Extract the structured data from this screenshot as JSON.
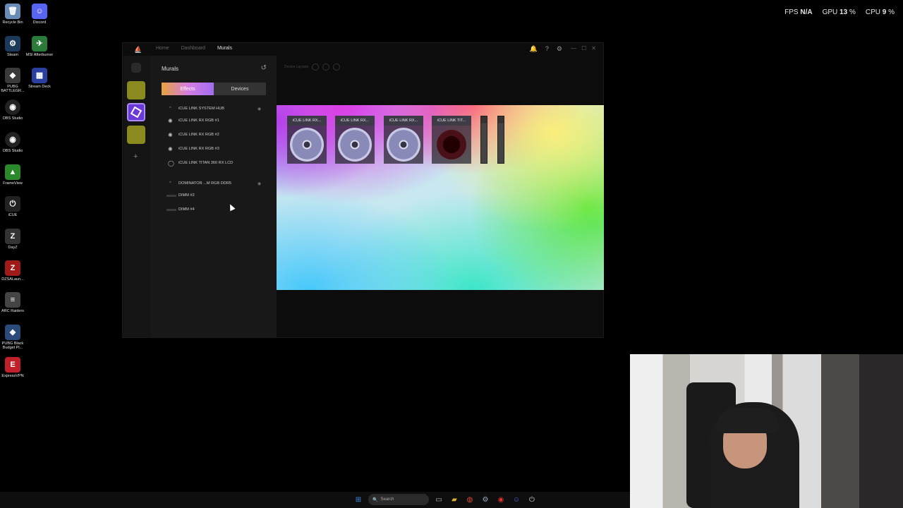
{
  "overlay": {
    "fps_label": "FPS",
    "fps_value": "N/A",
    "gpu_label": "GPU",
    "gpu_value": "13",
    "cpu_label": "CPU",
    "cpu_value": "9",
    "percent": "%"
  },
  "desktop_icons": [
    {
      "label": "Recycle Bin",
      "icon": "recycle-bin-icon",
      "color": "#6a8bb5"
    },
    {
      "label": "Discord",
      "icon": "discord-icon",
      "color": "#5865f2"
    },
    {
      "label": "Steam",
      "icon": "steam-icon",
      "color": "#1b3a5a"
    },
    {
      "label": "MSI Afterburner",
      "icon": "msi-afterburner-icon",
      "color": "#2a7a3a"
    },
    {
      "label": "PUBG BATTLEGR...",
      "icon": "pubg-icon",
      "color": "#3a3a3a"
    },
    {
      "label": "Stream Deck",
      "icon": "stream-deck-icon",
      "color": "#2a3fa0"
    },
    {
      "label": "OBS Studio",
      "icon": "obs-icon",
      "color": "#222222"
    },
    {
      "label": "OBS Studio",
      "icon": "obs-icon",
      "color": "#222222"
    },
    {
      "label": "FrameView",
      "icon": "frameview-icon",
      "color": "#2a8a2a"
    },
    {
      "label": "iCUE",
      "icon": "icue-icon",
      "color": "#222222"
    },
    {
      "label": "DayZ",
      "icon": "dayz-icon",
      "color": "#333333"
    },
    {
      "label": "DZSALaun...",
      "icon": "dzsa-icon",
      "color": "#a01a1a"
    },
    {
      "label": "ARC Raiders",
      "icon": "arc-raiders-icon",
      "color": "#444444"
    },
    {
      "label": "PUBG Black Budget Pl...",
      "icon": "pubg-black-budget-icon",
      "color": "#2a4a7a"
    },
    {
      "label": "ExpressVPN",
      "icon": "expressvpn-icon",
      "color": "#c0202a"
    }
  ],
  "app": {
    "nav": {
      "home": "Home",
      "dashboard": "Dashboard",
      "murals": "Murals"
    },
    "panel_title": "Murals",
    "tabs": {
      "effects": "Effects",
      "devices": "Devices"
    },
    "groups": [
      {
        "name": "iCUE LINK SYSTEM HUB",
        "items": [
          "iCUE LINK RX RGB #1",
          "iCUE LINK RX RGB #2",
          "iCUE LINK RX RGB #3",
          "iCUE LINK TITAN 360 RX LCD"
        ]
      },
      {
        "name": "DOMINATOR ...M RGB DDR5",
        "items": [
          "DIMM #2",
          "DIMM #4"
        ]
      }
    ],
    "device_layouts_label": "Device Layouts",
    "canvas_devices": [
      "iCUE LINK RX...",
      "iCUE LINK RX...",
      "iCUE LINK RX...",
      "iCUE LINK TIT..."
    ]
  },
  "taskbar": {
    "search_placeholder": "Search"
  },
  "colors": {
    "accent": "#8a5cf6",
    "rail_yellow": "#9a9a2a"
  }
}
